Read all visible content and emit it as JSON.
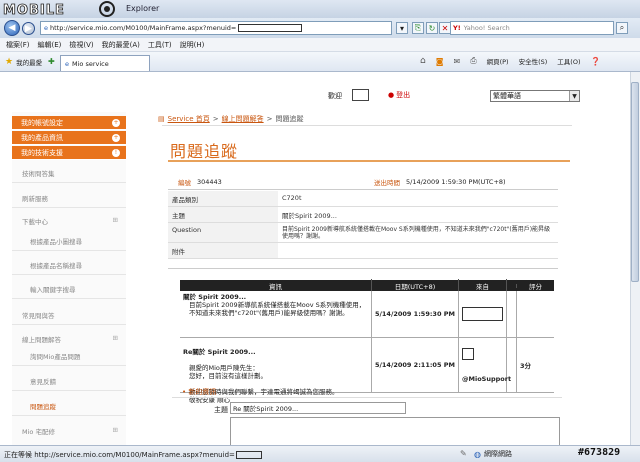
{
  "window": {
    "logo_text": "MOBILE01",
    "title": "Explorer"
  },
  "address_bar": {
    "url": "http://service.mio.com/M0100/MainFrame.aspx?menuid="
  },
  "search": {
    "placeholder": "Yahoo! Search"
  },
  "menu": [
    "檔案(F)",
    "編輯(E)",
    "檢視(V)",
    "我的最愛(A)",
    "工具(T)",
    "說明(H)"
  ],
  "favorites": {
    "label": "我的最愛",
    "tab_label": "Mio service",
    "toolbar_right": [
      "網頁(P)",
      "安全性(S)",
      "工具(O)"
    ]
  },
  "sidebar": {
    "orange_items": [
      {
        "label": "我的帳號設定",
        "icon": "+"
      },
      {
        "label": "我的產品資訊",
        "icon": "+"
      },
      {
        "label": "我的技術支援",
        "icon": "!"
      }
    ],
    "items": [
      {
        "label": "技術問答集",
        "indent": false
      },
      {
        "label": "刷新服務",
        "indent": false
      },
      {
        "label": "下載中心",
        "indent": false,
        "expand": true
      },
      {
        "label": "根據產品小圖搜尋",
        "indent": true
      },
      {
        "label": "根據產品名稱搜尋",
        "indent": true
      },
      {
        "label": "輸入關鍵字搜尋",
        "indent": true
      },
      {
        "label": "常見問與答",
        "indent": false
      },
      {
        "label": "線上問題解答",
        "indent": false,
        "expand": true
      },
      {
        "label": "詢問Mio產品問題",
        "indent": true
      },
      {
        "label": "意見反饋",
        "indent": true
      },
      {
        "label": "問題追蹤",
        "indent": true,
        "active": true
      },
      {
        "label": "Mio 宅配修",
        "indent": false,
        "expand": true
      }
    ]
  },
  "top_controls": {
    "login_label": "歡迎",
    "logout_label": "登出",
    "select_value": "繁體華語"
  },
  "breadcrumb": {
    "items": [
      "Service 首頁",
      "線上問題解答",
      "問題追蹤"
    ]
  },
  "page_title": "問題追蹤",
  "info": {
    "id_label": "編號",
    "id_value": "304443",
    "sent_label": "送出時間",
    "sent_value": "5/14/2009 1:59:30 PM(UTC+8)",
    "rows": [
      {
        "label": "產品類別",
        "value": "C720t"
      },
      {
        "label": "主題",
        "value": "關於Spirit 2009..."
      },
      {
        "label": "Question",
        "value": "目前Spirit 2009新導航系統僅搭載在Moov S系列機種使用，不知道未來我們\"c720t\"(舊用戶)能昇級使用嗎？謝謝。"
      },
      {
        "label": "附件",
        "value": ""
      }
    ]
  },
  "thread": {
    "headers": [
      "資訊",
      "日期(UTC+8)",
      "來自",
      "",
      "評分"
    ],
    "rows": [
      {
        "title": "關於 Spirit 2009...",
        "body": "目前Spirit 2009新導航系統僅搭載在Moov S系列機種使用，不知道未來我們\"c720t\"(舊用戶)能昇級使用嗎？謝謝。",
        "date": "5/14/2009 1:59:30 PM",
        "from": "",
        "score": ""
      },
      {
        "title": "Re關於 Spirit 2009...",
        "body": "親愛的Mio用戶陳先生：\n您好，目前沒有這樣計劃。\n\n歡迎您隨時與我們聯繫，宇達電通將竭誠為您服務。\n敬祝安康 順心",
        "date": "5/14/2009 2:11:05 PM",
        "from": "@MioSupport",
        "score": "3分"
      }
    ]
  },
  "reply": {
    "title": "新的資訊",
    "subject_label": "主題",
    "subject_value": "Re 關於Spirit 2009..."
  },
  "status": {
    "text": "正在等候 http://service.mio.com/M0100/MainFrame.aspx?menuid=",
    "zone": "網際網路",
    "watermark": "#673829"
  }
}
